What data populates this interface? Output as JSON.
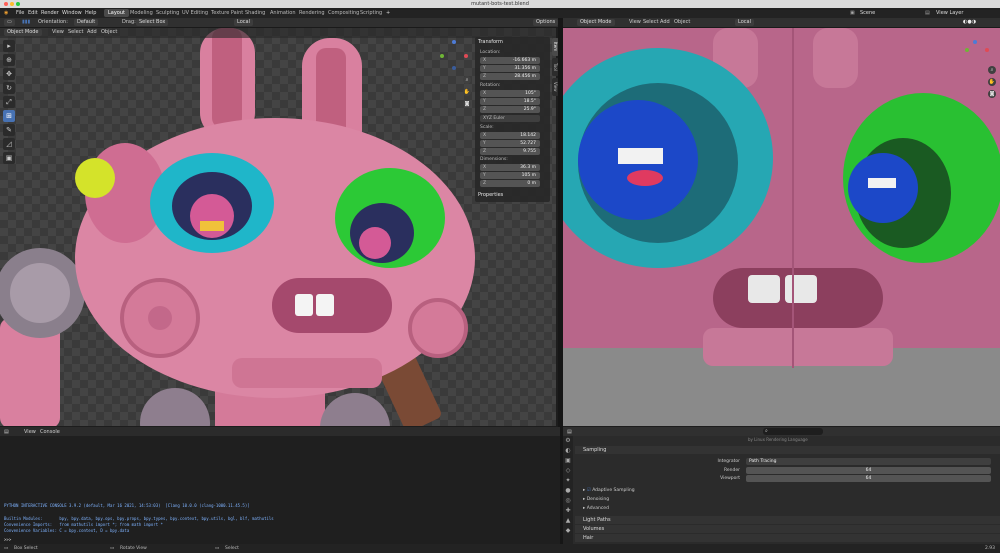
{
  "window": {
    "title": "mutant-bots-test.blend"
  },
  "menu": {
    "items": [
      "File",
      "Edit",
      "Render",
      "Window",
      "Help"
    ],
    "workspaces": [
      "Layout",
      "Modeling",
      "Sculpting",
      "UV Editing",
      "Texture Paint",
      "Shading",
      "Animation",
      "Rendering",
      "Compositing",
      "Scripting"
    ],
    "active_workspace": "Layout",
    "scene": "Scene",
    "view_layer": "View Layer"
  },
  "left_header": {
    "orientation_label": "Orientation:",
    "orientation_value": "Default",
    "drag_label": "Drag:",
    "drag_value": "Select Box",
    "mode": "Object Mode",
    "menus": [
      "View",
      "Select",
      "Add",
      "Object"
    ],
    "pivot": "Local",
    "options": "Options"
  },
  "right_header": {
    "mode": "Object Mode",
    "menus": [
      "View",
      "Select",
      "Add",
      "Object"
    ],
    "pivot": "Local"
  },
  "n_panel": {
    "transform": "Transform",
    "location_label": "Location:",
    "location": [
      {
        "axis": "X",
        "value": "-16.663 m"
      },
      {
        "axis": "Y",
        "value": "31.356 m"
      },
      {
        "axis": "Z",
        "value": "28.456 m"
      }
    ],
    "rotation_label": "Rotation:",
    "rotation": [
      {
        "axis": "X",
        "value": "105°"
      },
      {
        "axis": "Y",
        "value": "18.5°"
      },
      {
        "axis": "Z",
        "value": "25.9°"
      }
    ],
    "rotation_mode": "XYZ Euler",
    "scale_label": "Scale:",
    "scale": [
      {
        "axis": "X",
        "value": "18.142"
      },
      {
        "axis": "Y",
        "value": "52.727"
      },
      {
        "axis": "Z",
        "value": "9.755"
      }
    ],
    "dimensions_label": "Dimensions:",
    "dimensions": [
      {
        "axis": "X",
        "value": "36.3 m"
      },
      {
        "axis": "Y",
        "value": "105 m"
      },
      {
        "axis": "Z",
        "value": "0 m"
      }
    ],
    "properties": "Properties",
    "tabs": [
      "Item",
      "Tool",
      "View"
    ]
  },
  "console": {
    "menus": [
      "View",
      "Console"
    ],
    "lines": [
      "PYTHON INTERACTIVE CONSOLE 3.9.2 (default, Mar 16 2021, 14:53:03)  [Clang 10.0.0 (clang-1000.11.45.5)]",
      "",
      "Builtin Modules:       bpy, bpy.data, bpy.ops, bpy.props, bpy.types, bpy.context, bpy.utils, bgl, blf, mathutils",
      "Convenience Imports:   from mathutils import *; from math import *",
      "Convenience Variables: C = bpy.context, D = bpy.data"
    ]
  },
  "properties": {
    "search_hint": "by Linux Rendering Language",
    "sampling": "Sampling",
    "integrator_label": "Integrator",
    "integrator_value": "Path Tracing",
    "render_label": "Render",
    "render_value": "64",
    "viewport_label": "Viewport",
    "viewport_value": "64",
    "adaptive_sampling": "Adaptive Sampling",
    "denoising": "Denoising",
    "advanced": "Advanced",
    "light_paths": "Light Paths",
    "volumes": "Volumes",
    "hair": "Hair"
  },
  "status": {
    "select": "Box Select",
    "rotate": "Rotate View",
    "context": "Select",
    "version": "2.93"
  },
  "colors": {
    "accent": "#4772b3",
    "robot_pink": "#d9809f",
    "eye_cyan": "#1fb6c9",
    "eye_green": "#2cc936",
    "ball_blue": "#1f4fd6"
  }
}
